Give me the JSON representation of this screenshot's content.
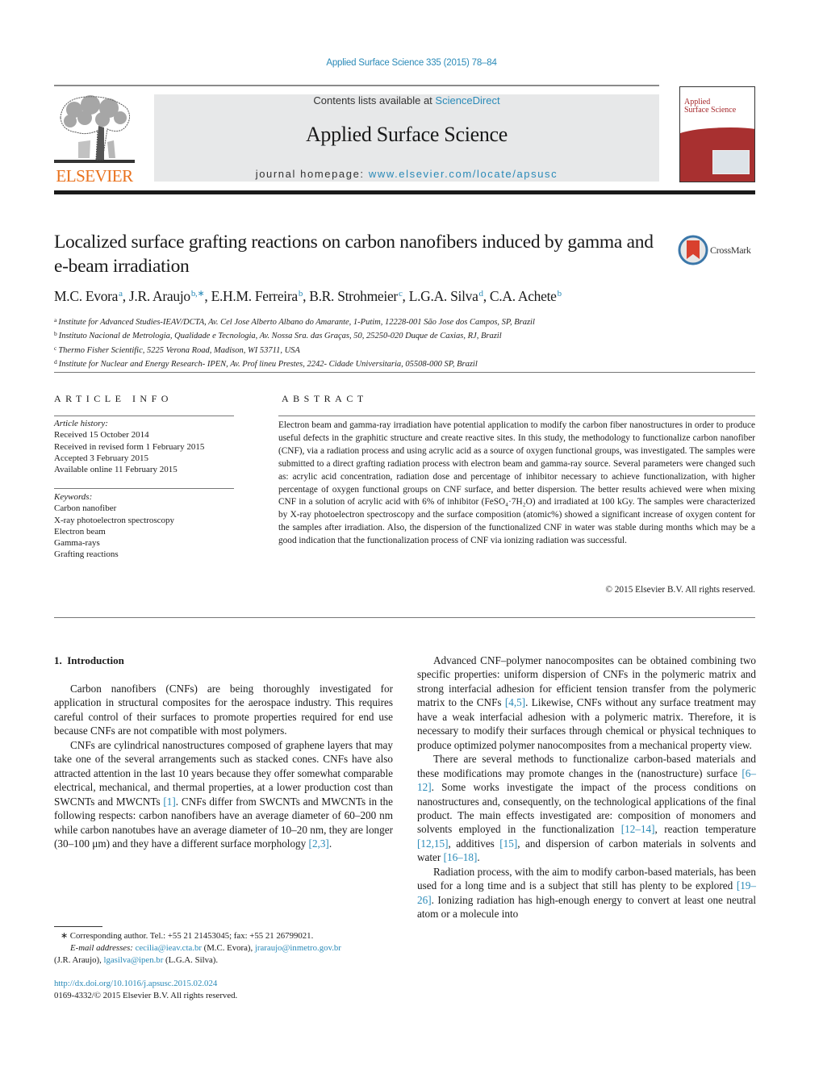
{
  "header": {
    "citation": "Applied Surface Science 335 (2015) 78–84",
    "publisher_logo_text": "ELSEVIER",
    "contents_prefix": "Contents lists available at ",
    "contents_link": "ScienceDirect",
    "journal_title": "Applied Surface Science",
    "homepage_prefix": "journal homepage: ",
    "homepage_link": "www.elsevier.com/locate/apsusc",
    "cover_title_line1": "Applied",
    "cover_title_line2": "Surface Science",
    "crossmark_label": "CrossMark"
  },
  "article": {
    "title": "Localized surface grafting reactions on carbon nanofibers induced by gamma and e-beam irradiation",
    "authors": [
      {
        "name": "M.C. Evora",
        "sup": "a"
      },
      {
        "name": "J.R. Araujo",
        "sup": "b,∗"
      },
      {
        "name": "E.H.M. Ferreira",
        "sup": "b"
      },
      {
        "name": "B.R. Strohmeier",
        "sup": "c"
      },
      {
        "name": "L.G.A. Silva",
        "sup": "d"
      },
      {
        "name": "C.A. Achete",
        "sup": "b"
      }
    ],
    "affiliations": [
      {
        "key": "a",
        "text": "Institute for Advanced Studies-IEAV/DCTA, Av. Cel Jose Alberto Albano do Amarante, 1-Putim, 12228-001 São Jose dos Campos, SP, Brazil"
      },
      {
        "key": "b",
        "text": "Instituto Nacional de Metrologia, Qualidade e Tecnologia, Av. Nossa Sra. das Graças, 50, 25250-020 Duque de Caxias, RJ, Brazil"
      },
      {
        "key": "c",
        "text": "Thermo Fisher Scientific, 5225 Verona Road, Madison, WI 53711, USA"
      },
      {
        "key": "d",
        "text": "Institute for Nuclear and Energy Research- IPEN, Av. Prof lineu Prestes, 2242- Cidade Universitaria, 05508-000 SP, Brazil"
      }
    ]
  },
  "article_info": {
    "heading": "ARTICLE INFO",
    "history_label": "Article history:",
    "history": [
      "Received 15 October 2014",
      "Received in revised form 1 February 2015",
      "Accepted 3 February 2015",
      "Available online 11 February 2015"
    ],
    "keywords_label": "Keywords:",
    "keywords": [
      "Carbon nanofiber",
      "X-ray photoelectron spectroscopy",
      "Electron beam",
      "Gamma-rays",
      "Grafting reactions"
    ]
  },
  "abstract": {
    "heading": "ABSTRACT",
    "text_part1": "Electron beam and gamma-ray irradiation have potential application to modify the carbon fiber nanostructures in order to produce useful defects in the graphitic structure and create reactive sites. In this study, the methodology to functionalize carbon nanofiber (CNF), via a radiation process and using acrylic acid as a source of oxygen functional groups, was investigated. The samples were submitted to a direct grafting radiation process with electron beam and gamma-ray source. Several parameters were changed such as: acrylic acid concentration, radiation dose and percentage of inhibitor necessary to achieve functionalization, with higher percentage of oxygen functional groups on CNF surface, and better dispersion. The better results achieved were when mixing CNF in a solution of acrylic acid with 6% of inhibitor (",
    "formula": "FeSO₄·7H₂O",
    "text_part2": ") and irradiated at 100 kGy. The samples were characterized by X-ray photoelectron spectroscopy and the surface composition (atomic%) showed a significant increase of oxygen content for the samples after irradiation. Also, the dispersion of the functionalized CNF in water was stable during months which may be a good indication that the functionalization process of CNF via ionizing radiation was successful.",
    "copyright": "© 2015 Elsevier B.V. All rights reserved."
  },
  "introduction": {
    "heading": "1.  Introduction",
    "left": {
      "p1": "Carbon nanofibers (CNFs) are being thoroughly investigated for application in structural composites for the aerospace industry. This requires careful control of their surfaces to promote properties required for end use because CNFs are not compatible with most polymers.",
      "p2_a": "CNFs are cylindrical nanostructures composed of graphene layers that may take one of the several arrangements such as stacked cones. CNFs have also attracted attention in the last 10 years because they offer somewhat comparable electrical, mechanical, and thermal properties, at a lower production cost than SWCNTs and MWCNTs ",
      "p2_ref1": "[1]",
      "p2_b": ". CNFs differ from SWCNTs and MWCNTs in the following respects: carbon nanofibers have an average diameter of 60–200 nm while carbon nanotubes have an average diameter of 10–20 nm, they are longer (30–100 μm) and they have a different surface morphology ",
      "p2_ref2": "[2,3]",
      "p2_c": "."
    },
    "right": {
      "p1_a": "Advanced CNF–polymer nanocomposites can be obtained combining two specific properties: uniform dispersion of CNFs in the polymeric matrix and strong interfacial adhesion for efficient tension transfer from the polymeric matrix to the CNFs ",
      "p1_ref": "[4,5]",
      "p1_b": ". Likewise, CNFs without any surface treatment may have a weak interfacial adhesion with a polymeric matrix. Therefore, it is necessary to modify their surfaces through chemical or physical techniques to produce optimized polymer nanocomposites from a mechanical property view.",
      "p2_a": "There are several methods to functionalize carbon-based materials and these modifications may promote changes in the (nanostructure) surface ",
      "p2_ref1": "[6–12]",
      "p2_b": ". Some works investigate the impact of the process conditions on nanostructures and, consequently, on the technological applications of the final product. The main effects investigated are: composition of monomers and solvents employed in the functionalization ",
      "p2_ref2": "[12–14]",
      "p2_c": ", reaction temperature ",
      "p2_ref3": "[12,15]",
      "p2_d": ", additives ",
      "p2_ref4": "[15]",
      "p2_e": ", and dispersion of carbon materials in solvents and water ",
      "p2_ref5": "[16–18]",
      "p2_f": ".",
      "p3_a": "Radiation process, with the aim to modify carbon-based materials, has been used for a long time and is a subject that still has plenty to be explored ",
      "p3_ref": "[19–26]",
      "p3_b": ". Ionizing radiation has high-enough energy to convert at least one neutral atom or a molecule into"
    }
  },
  "footnotes": {
    "corresponding": "∗  Corresponding author. Tel.: +55 21 21453045; fax: +55 21 26799021.",
    "email_label": "E-mail addresses:",
    "email1": "cecilia@ieav.cta.br",
    "email1_owner": " (M.C. Evora), ",
    "email2": "jraraujo@inmetro.gov.br",
    "email2_owner": "(J.R. Araujo), ",
    "email3": "lgasilva@ipen.br",
    "email3_owner": " (L.G.A. Silva).",
    "doi": "http://dx.doi.org/10.1016/j.apsusc.2015.02.024",
    "issn_copyright": "0169-4332/© 2015 Elsevier B.V. All rights reserved."
  },
  "colors": {
    "link": "#2a8ab8",
    "elsevier_orange": "#e9711c",
    "masthead_bg": "#e7e8e9",
    "cover_red": "#a83030"
  }
}
